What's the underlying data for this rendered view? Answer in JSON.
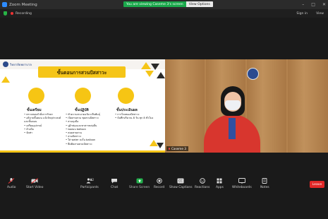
{
  "app": {
    "window_title": "Zoom Meeting"
  },
  "banner": {
    "message": "You are viewing Caseme 3's screen",
    "view_options": "View Options"
  },
  "status": {
    "recording": "Recording",
    "sign_in": "Sign in",
    "view": "View"
  },
  "slide": {
    "dept": "วิทยาลัยพยาบาล",
    "title": "ขั้นตอนการสวนปัสสาวะ",
    "columns": [
      {
        "heading": "ขั้นเตรียม",
        "items": [
          "ตรวจสอบคำสั่งการรักษา",
          "อธิบายขั้นตอน แจ้งวัตถุประสงค์ และขั้นตอน",
          "เตรียมอุปกรณ์",
          "ล้างมือ",
          "จัดท่า"
        ]
      },
      {
        "heading": "ขั้นปฏิบัติ",
        "items": [
          "ทำความสะอาดอวัยวะสืบพันธุ์",
          "เปิดสายสวน ชุดสวนปัสสาวะ",
          "สวมถุงมือ",
          "ปูผ้าช่องและทาสารหล่อลื่น",
          "ทดสอบ balloon",
          "สอดสายสวน",
          "สวมปัสสาวะ",
          "ใส่ water ลงใน balloon",
          "ยึดติดสายสวนปัสสาวะ"
        ]
      },
      {
        "heading": "ขั้นประเมินผล",
        "items": [
          "การไหลของปัสสาวะ",
          "บันทึกปริมาณ 8 วัน ทุก 8 ชั่วโมง"
        ]
      }
    ]
  },
  "video": {
    "participant_name": "Caseme 3"
  },
  "toolbar": {
    "items": [
      {
        "label": "Audio",
        "icon": "microphone-muted-icon"
      },
      {
        "label": "Start Video",
        "icon": "video-off-icon"
      },
      {
        "label": "Participants",
        "count": "12",
        "icon": "participants-icon"
      },
      {
        "label": "Chat",
        "icon": "chat-icon"
      },
      {
        "label": "Share Screen",
        "icon": "share-screen-icon"
      },
      {
        "label": "Record",
        "icon": "record-icon"
      },
      {
        "label": "Show Captions",
        "icon": "captions-icon"
      },
      {
        "label": "Reactions",
        "icon": "reactions-icon"
      },
      {
        "label": "Apps",
        "icon": "apps-icon"
      },
      {
        "label": "Whiteboards",
        "icon": "whiteboard-icon"
      },
      {
        "label": "Notes",
        "icon": "notes-icon"
      }
    ],
    "leave": "Leave"
  },
  "colors": {
    "accent_green": "#1aa84b",
    "leave_red": "#e02828",
    "slide_yellow": "#f5c518"
  }
}
